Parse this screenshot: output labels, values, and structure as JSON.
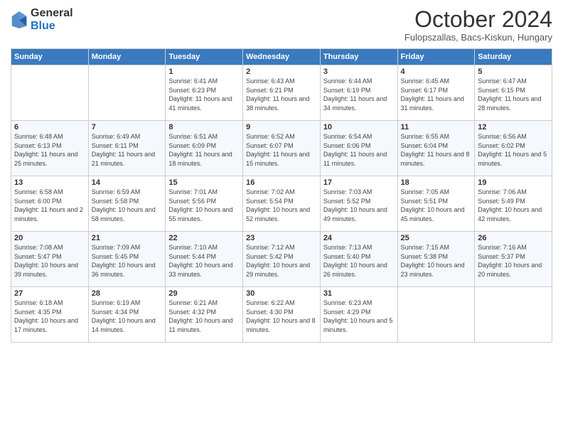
{
  "logo": {
    "general": "General",
    "blue": "Blue"
  },
  "header": {
    "month": "October 2024",
    "location": "Fulopszallas, Bacs-Kiskun, Hungary"
  },
  "weekdays": [
    "Sunday",
    "Monday",
    "Tuesday",
    "Wednesday",
    "Thursday",
    "Friday",
    "Saturday"
  ],
  "weeks": [
    [
      {
        "day": "",
        "info": ""
      },
      {
        "day": "",
        "info": ""
      },
      {
        "day": "1",
        "info": "Sunrise: 6:41 AM\nSunset: 6:23 PM\nDaylight: 11 hours and 41 minutes."
      },
      {
        "day": "2",
        "info": "Sunrise: 6:43 AM\nSunset: 6:21 PM\nDaylight: 11 hours and 38 minutes."
      },
      {
        "day": "3",
        "info": "Sunrise: 6:44 AM\nSunset: 6:19 PM\nDaylight: 11 hours and 34 minutes."
      },
      {
        "day": "4",
        "info": "Sunrise: 6:45 AM\nSunset: 6:17 PM\nDaylight: 11 hours and 31 minutes."
      },
      {
        "day": "5",
        "info": "Sunrise: 6:47 AM\nSunset: 6:15 PM\nDaylight: 11 hours and 28 minutes."
      }
    ],
    [
      {
        "day": "6",
        "info": "Sunrise: 6:48 AM\nSunset: 6:13 PM\nDaylight: 11 hours and 25 minutes."
      },
      {
        "day": "7",
        "info": "Sunrise: 6:49 AM\nSunset: 6:11 PM\nDaylight: 11 hours and 21 minutes."
      },
      {
        "day": "8",
        "info": "Sunrise: 6:51 AM\nSunset: 6:09 PM\nDaylight: 11 hours and 18 minutes."
      },
      {
        "day": "9",
        "info": "Sunrise: 6:52 AM\nSunset: 6:07 PM\nDaylight: 11 hours and 15 minutes."
      },
      {
        "day": "10",
        "info": "Sunrise: 6:54 AM\nSunset: 6:06 PM\nDaylight: 11 hours and 11 minutes."
      },
      {
        "day": "11",
        "info": "Sunrise: 6:55 AM\nSunset: 6:04 PM\nDaylight: 11 hours and 8 minutes."
      },
      {
        "day": "12",
        "info": "Sunrise: 6:56 AM\nSunset: 6:02 PM\nDaylight: 11 hours and 5 minutes."
      }
    ],
    [
      {
        "day": "13",
        "info": "Sunrise: 6:58 AM\nSunset: 6:00 PM\nDaylight: 11 hours and 2 minutes."
      },
      {
        "day": "14",
        "info": "Sunrise: 6:59 AM\nSunset: 5:58 PM\nDaylight: 10 hours and 58 minutes."
      },
      {
        "day": "15",
        "info": "Sunrise: 7:01 AM\nSunset: 5:56 PM\nDaylight: 10 hours and 55 minutes."
      },
      {
        "day": "16",
        "info": "Sunrise: 7:02 AM\nSunset: 5:54 PM\nDaylight: 10 hours and 52 minutes."
      },
      {
        "day": "17",
        "info": "Sunrise: 7:03 AM\nSunset: 5:52 PM\nDaylight: 10 hours and 49 minutes."
      },
      {
        "day": "18",
        "info": "Sunrise: 7:05 AM\nSunset: 5:51 PM\nDaylight: 10 hours and 45 minutes."
      },
      {
        "day": "19",
        "info": "Sunrise: 7:06 AM\nSunset: 5:49 PM\nDaylight: 10 hours and 42 minutes."
      }
    ],
    [
      {
        "day": "20",
        "info": "Sunrise: 7:08 AM\nSunset: 5:47 PM\nDaylight: 10 hours and 39 minutes."
      },
      {
        "day": "21",
        "info": "Sunrise: 7:09 AM\nSunset: 5:45 PM\nDaylight: 10 hours and 36 minutes."
      },
      {
        "day": "22",
        "info": "Sunrise: 7:10 AM\nSunset: 5:44 PM\nDaylight: 10 hours and 33 minutes."
      },
      {
        "day": "23",
        "info": "Sunrise: 7:12 AM\nSunset: 5:42 PM\nDaylight: 10 hours and 29 minutes."
      },
      {
        "day": "24",
        "info": "Sunrise: 7:13 AM\nSunset: 5:40 PM\nDaylight: 10 hours and 26 minutes."
      },
      {
        "day": "25",
        "info": "Sunrise: 7:15 AM\nSunset: 5:38 PM\nDaylight: 10 hours and 23 minutes."
      },
      {
        "day": "26",
        "info": "Sunrise: 7:16 AM\nSunset: 5:37 PM\nDaylight: 10 hours and 20 minutes."
      }
    ],
    [
      {
        "day": "27",
        "info": "Sunrise: 6:18 AM\nSunset: 4:35 PM\nDaylight: 10 hours and 17 minutes."
      },
      {
        "day": "28",
        "info": "Sunrise: 6:19 AM\nSunset: 4:34 PM\nDaylight: 10 hours and 14 minutes."
      },
      {
        "day": "29",
        "info": "Sunrise: 6:21 AM\nSunset: 4:32 PM\nDaylight: 10 hours and 11 minutes."
      },
      {
        "day": "30",
        "info": "Sunrise: 6:22 AM\nSunset: 4:30 PM\nDaylight: 10 hours and 8 minutes."
      },
      {
        "day": "31",
        "info": "Sunrise: 6:23 AM\nSunset: 4:29 PM\nDaylight: 10 hours and 5 minutes."
      },
      {
        "day": "",
        "info": ""
      },
      {
        "day": "",
        "info": ""
      }
    ]
  ]
}
